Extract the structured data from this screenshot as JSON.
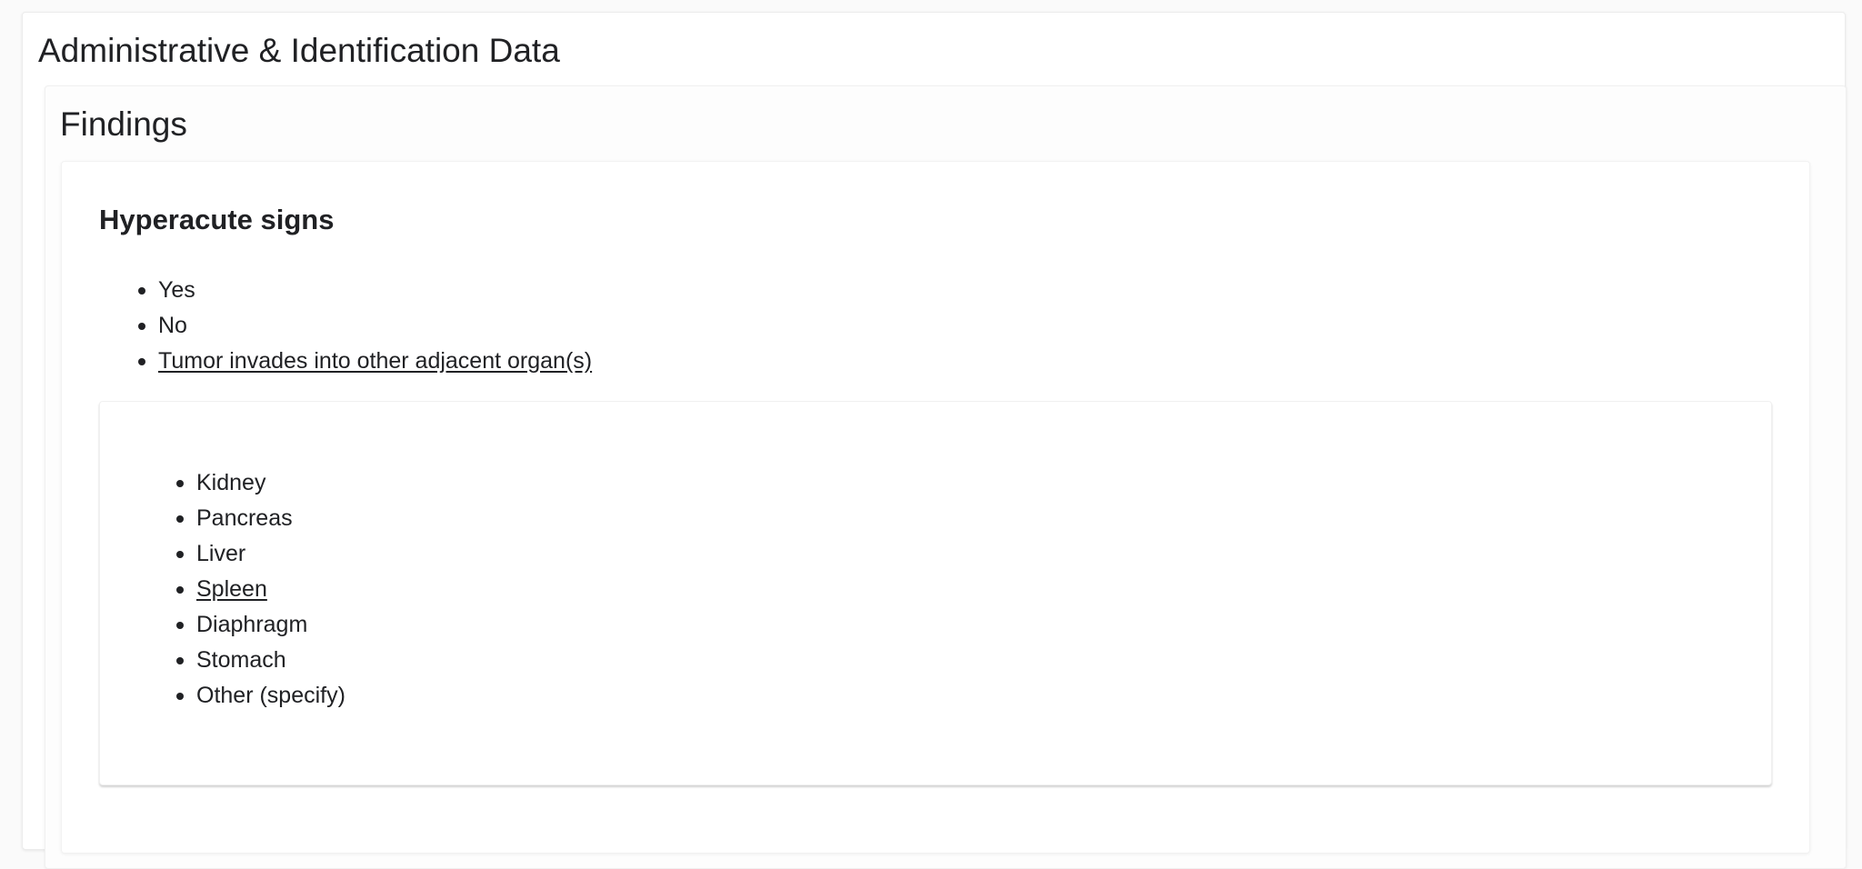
{
  "section": {
    "title": "Administrative & Identification Data",
    "subsection": {
      "title": "Findings",
      "question": {
        "title": "Hyperacute signs",
        "options": [
          {
            "label": "Yes",
            "underlined": false
          },
          {
            "label": "No",
            "underlined": false
          },
          {
            "label": "Tumor invades into other adjacent organ(s)",
            "underlined": true
          }
        ],
        "sub_options": [
          {
            "label": "Kidney",
            "underlined": false
          },
          {
            "label": "Pancreas",
            "underlined": false
          },
          {
            "label": "Liver",
            "underlined": false
          },
          {
            "label": "Spleen",
            "underlined": true
          },
          {
            "label": "Diaphragm",
            "underlined": false
          },
          {
            "label": "Stomach",
            "underlined": false
          },
          {
            "label": "Other (specify)",
            "underlined": false
          }
        ]
      }
    }
  }
}
